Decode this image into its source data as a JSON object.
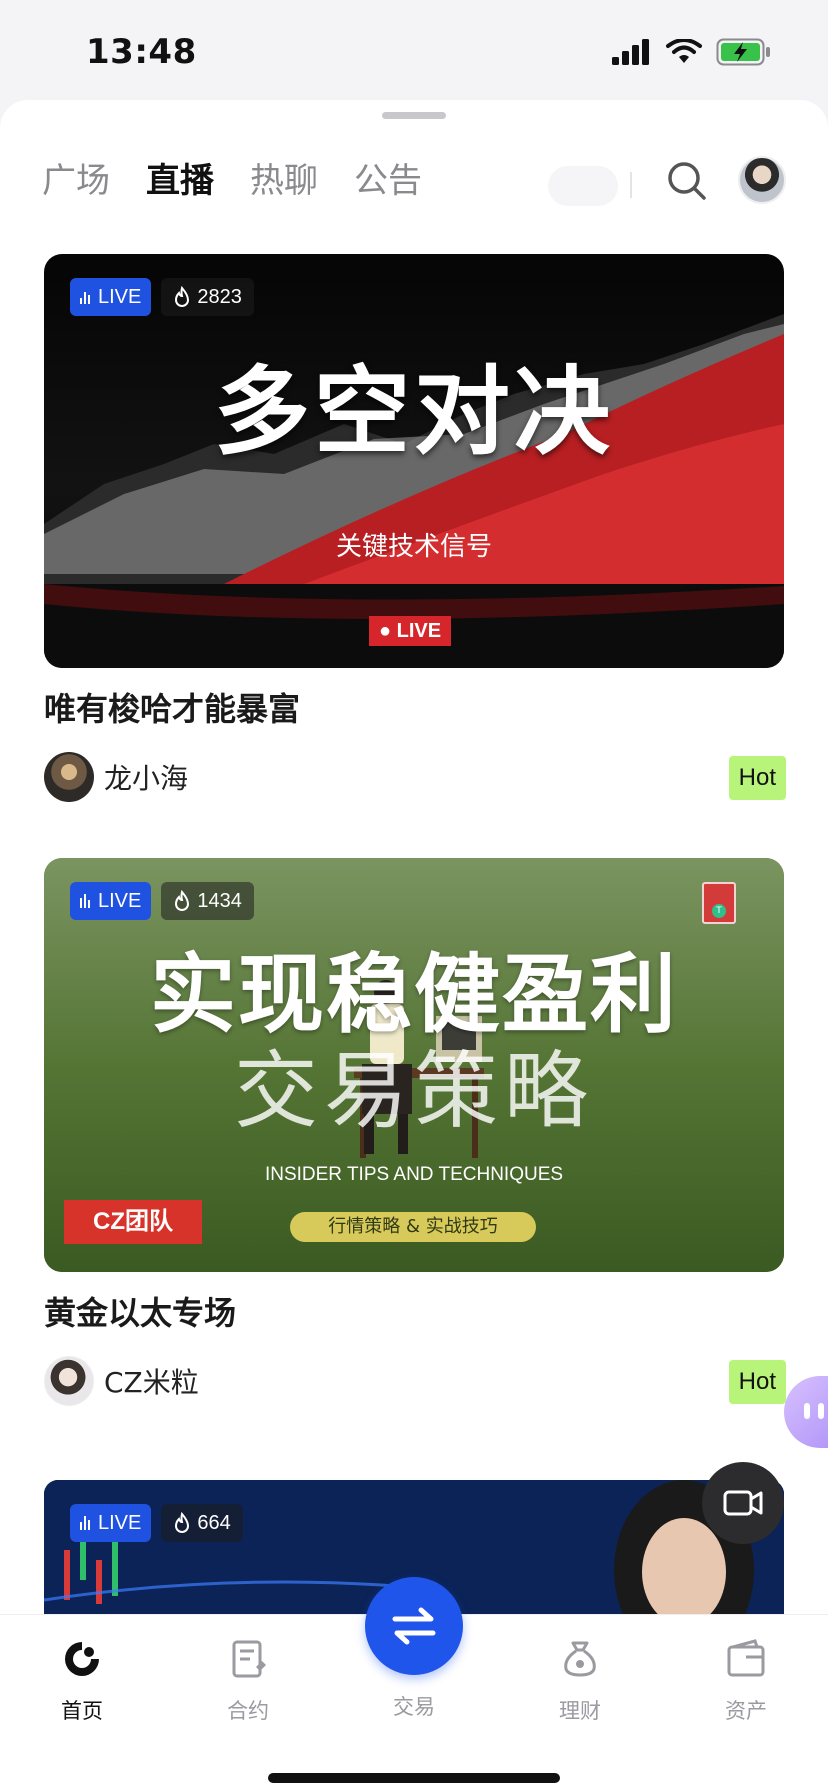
{
  "status_bar": {
    "time": "13:48"
  },
  "header": {
    "tabs": [
      {
        "label": "广场",
        "active": false
      },
      {
        "label": "直播",
        "active": true
      },
      {
        "label": "热聊",
        "active": false
      },
      {
        "label": "公告",
        "active": false
      }
    ]
  },
  "streams": [
    {
      "live_label": "LIVE",
      "views": "2823",
      "cover_title": "多空对决",
      "cover_subtitle": "关键技术信号",
      "cover_live": "● LIVE",
      "title": "唯有梭哈才能暴富",
      "author": "龙小海",
      "badge": "Hot"
    },
    {
      "live_label": "LIVE",
      "views": "1434",
      "cover_line1": "实现稳健盈利",
      "cover_line2": "交易策略",
      "cover_english": "INSIDER TIPS AND TECHNIQUES",
      "cover_pill": "行情策略 & 实战技巧",
      "cover_team": "CZ团队",
      "title": "黄金以太专场",
      "author": "CZ米粒",
      "badge": "Hot"
    },
    {
      "live_label": "LIVE",
      "views": "664"
    }
  ],
  "tabbar": {
    "items": [
      {
        "label": "首页",
        "icon": "home-icon",
        "active": true
      },
      {
        "label": "合约",
        "icon": "contract-icon",
        "active": false
      },
      {
        "label": "交易",
        "icon": "trade-icon",
        "active": false
      },
      {
        "label": "理财",
        "icon": "wealth-icon",
        "active": false
      },
      {
        "label": "资产",
        "icon": "wallet-icon",
        "active": false
      }
    ]
  },
  "colors": {
    "accent": "#1f55ea",
    "live_badge": "#1f52e0",
    "hot_badge": "#b9f47a"
  }
}
